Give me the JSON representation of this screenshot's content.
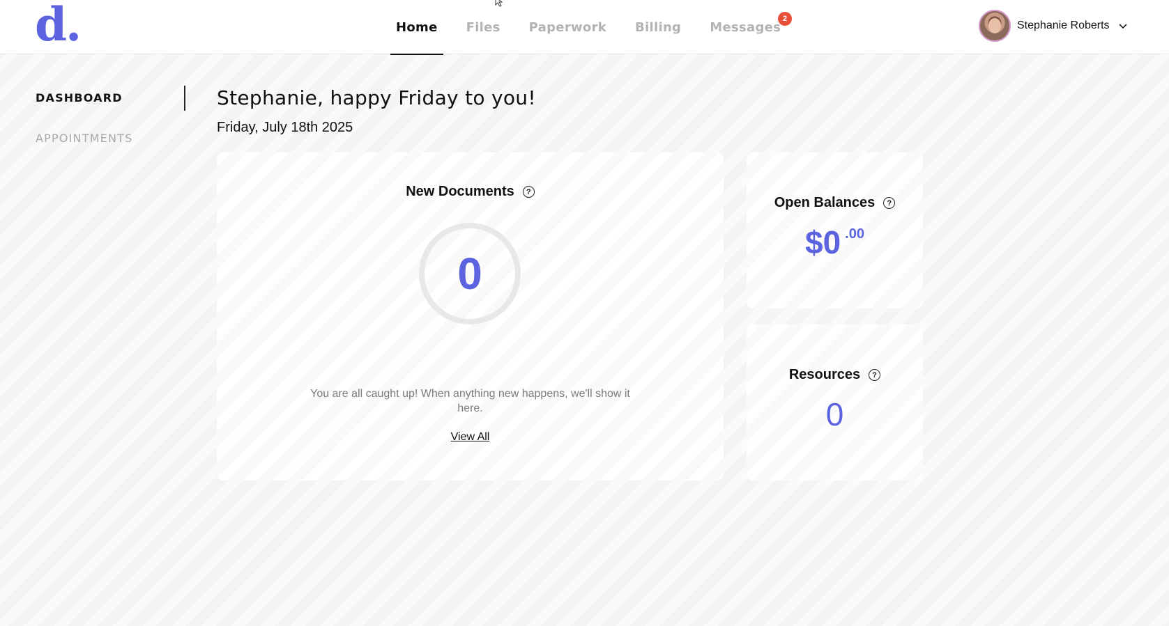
{
  "brand": {
    "logo_text": "d.",
    "accent_color": "#5b63e0"
  },
  "nav": {
    "tabs": [
      {
        "label": "Home",
        "active": true
      },
      {
        "label": "Files",
        "active": false
      },
      {
        "label": "Paperwork",
        "active": false
      },
      {
        "label": "Billing",
        "active": false
      },
      {
        "label": "Messages",
        "active": false,
        "badge": "2"
      }
    ]
  },
  "user": {
    "name": "Stephanie Roberts",
    "avatar_icon": "user-avatar",
    "menu_icon": "chevron-down-icon"
  },
  "sidebar": {
    "items": [
      {
        "label": "DASHBOARD",
        "active": true
      },
      {
        "label": "APPOINTMENTS",
        "active": false
      }
    ]
  },
  "main": {
    "greeting": "Stephanie, happy Friday to you!",
    "date": "Friday, July 18th 2025",
    "new_documents": {
      "title": "New Documents",
      "count": "0",
      "empty_message": "You are all caught up! When anything new happens, we'll show it here.",
      "view_all": "View All"
    },
    "open_balances": {
      "title": "Open Balances",
      "amount": "$0",
      "cents": ".00"
    },
    "resources": {
      "title": "Resources",
      "count": "0"
    },
    "help_icon_glyph": "?"
  },
  "colors": {
    "badge": "#e8503a",
    "muted_text": "#b3b3b3"
  }
}
